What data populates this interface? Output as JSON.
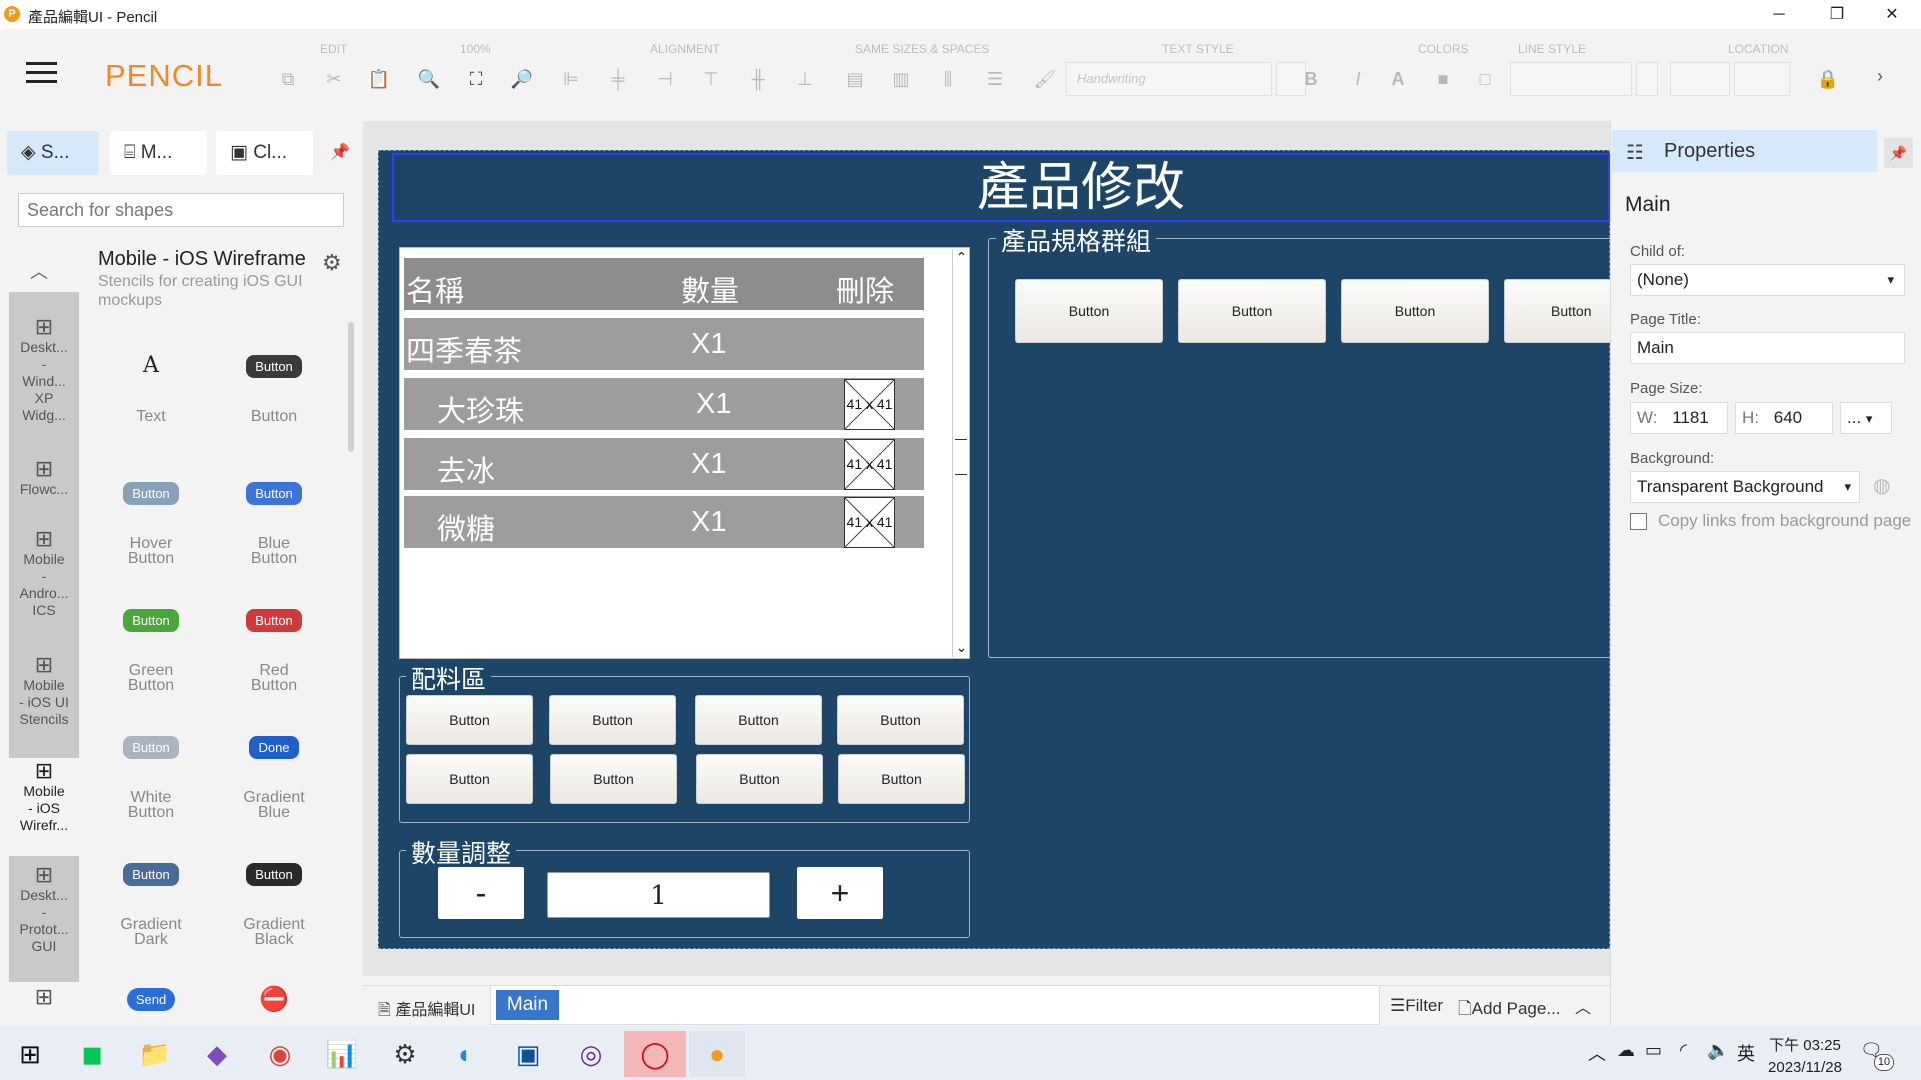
{
  "window": {
    "title": "產品編輯UI - Pencil",
    "app_icon_letter": "P",
    "controls": {
      "minimize": "─",
      "restore": "❐",
      "close": "✕"
    }
  },
  "toolbar": {
    "logo": "PENCIL",
    "groups": [
      "EDIT",
      "100%",
      "ALIGNMENT",
      "SAME SIZES & SPACES",
      "TEXT STYLE",
      "COLORS",
      "LINE STYLE",
      "LOCATION"
    ],
    "font_value": "Handwriting",
    "bold": "B",
    "italic": "I",
    "expand": "›"
  },
  "left_panel": {
    "tabs": [
      "S...",
      "M...",
      "Cl..."
    ],
    "search_placeholder": "Search for shapes",
    "categories": [
      {
        "label": "Deskt...\n-\nWind...\nXP\nWidg..."
      },
      {
        "label": "Flowc..."
      },
      {
        "label": "Mobile\n-\nAndro...\nICS"
      },
      {
        "label": "Mobile\n- iOS UI\nStencils"
      },
      {
        "label": "Mobile\n- iOS\nWirefr..."
      },
      {
        "label": "Deskt...\n-\nProtot...\nGUI"
      }
    ],
    "collection_title": "Mobile - iOS Wireframe",
    "collection_desc": "Stencils for creating iOS GUI mockups",
    "shapes": [
      {
        "label": "Text",
        "preview": "A"
      },
      {
        "label": "Button",
        "preview": "Button"
      },
      {
        "label": "Hover\nButton",
        "preview": "Button"
      },
      {
        "label": "Blue\nButton",
        "preview": "Button"
      },
      {
        "label": "Green\nButton",
        "preview": "Button"
      },
      {
        "label": "Red\nButton",
        "preview": "Button"
      },
      {
        "label": "White\nButton",
        "preview": "Button"
      },
      {
        "label": "Gradient\nBlue",
        "preview": "Done"
      },
      {
        "label": "Gradient\nDark",
        "preview": "Button"
      },
      {
        "label": "Gradient\nBlack",
        "preview": "Button"
      },
      {
        "label": "",
        "preview": "Send"
      },
      {
        "label": "",
        "preview": "⛔"
      }
    ]
  },
  "canvas": {
    "header": "產品修改",
    "list": {
      "columns": [
        "名稱",
        "數量",
        "刪除"
      ],
      "rows": [
        {
          "name": "四季春茶",
          "qty": "X1"
        },
        {
          "name": "大珍珠",
          "qty": "X1",
          "placeholder": "41 x 41"
        },
        {
          "name": "去冰",
          "qty": "X1",
          "placeholder": "41 x 41"
        },
        {
          "name": "微糖",
          "qty": "X1",
          "placeholder": "41 x 41"
        }
      ]
    },
    "spec_group": {
      "title": "產品規格群組",
      "buttons": [
        "Button",
        "Button",
        "Button",
        "Button"
      ]
    },
    "toppings": {
      "title": "配料區",
      "buttons": [
        "Button",
        "Button",
        "Button",
        "Button",
        "Button",
        "Button",
        "Button",
        "Button"
      ]
    },
    "quantity": {
      "title": "數量調整",
      "minus": "-",
      "value": "1",
      "plus": "+"
    }
  },
  "properties": {
    "header": "Properties",
    "name": "Main",
    "child_of_label": "Child of:",
    "child_of_value": "(None)",
    "page_title_label": "Page Title:",
    "page_title_value": "Main",
    "page_size_label": "Page Size:",
    "w_label": "W:",
    "w_value": "1181",
    "h_label": "H:",
    "h_value": "640",
    "size_preset": "...",
    "background_label": "Background:",
    "background_value": "Transparent Background",
    "copy_links": "Copy links from background page"
  },
  "bottom": {
    "doc_name": "產品編輯UI",
    "active_page": "Main",
    "filter": "Filter",
    "add_page": "Add Page..."
  },
  "taskbar": {
    "time": "下午 03:25",
    "date": "2023/11/28",
    "ime": "英",
    "notifications": "10"
  }
}
